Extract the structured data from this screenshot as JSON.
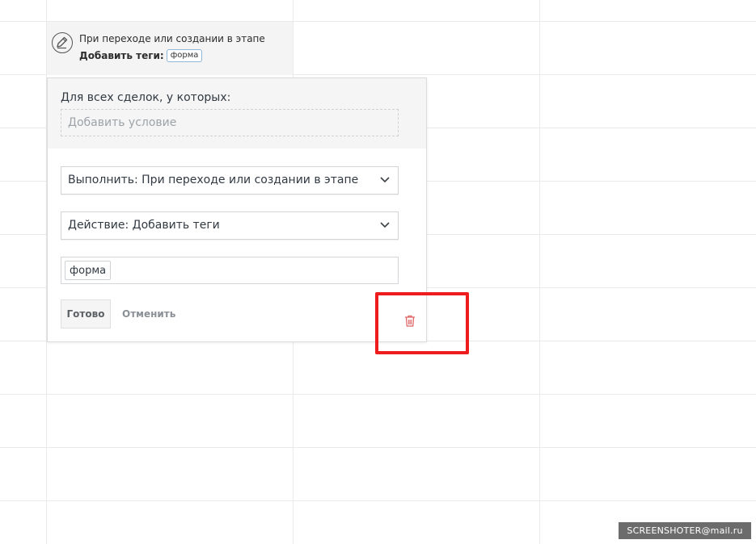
{
  "trigger": {
    "line1": "При переходе или создании в этапе",
    "line2_label": "Добавить теги:",
    "tag": "форма"
  },
  "popup": {
    "condition_label": "Для всех сделок, у которых:",
    "condition_placeholder": "Добавить условие",
    "execute_select": "Выполнить: При переходе или создании в этапе",
    "action_select": "Действие: Добавить теги",
    "tags": [
      "форма"
    ],
    "done_label": "Готово",
    "cancel_label": "Отменить"
  },
  "icons": {
    "edit": "pencil-icon",
    "delete": "trash-icon",
    "dropdown": "chevron-down-icon"
  },
  "colors": {
    "highlight": "#ee1c1c",
    "trash": "#e06565"
  },
  "watermark": "SCREENSHOTER@mail.ru"
}
